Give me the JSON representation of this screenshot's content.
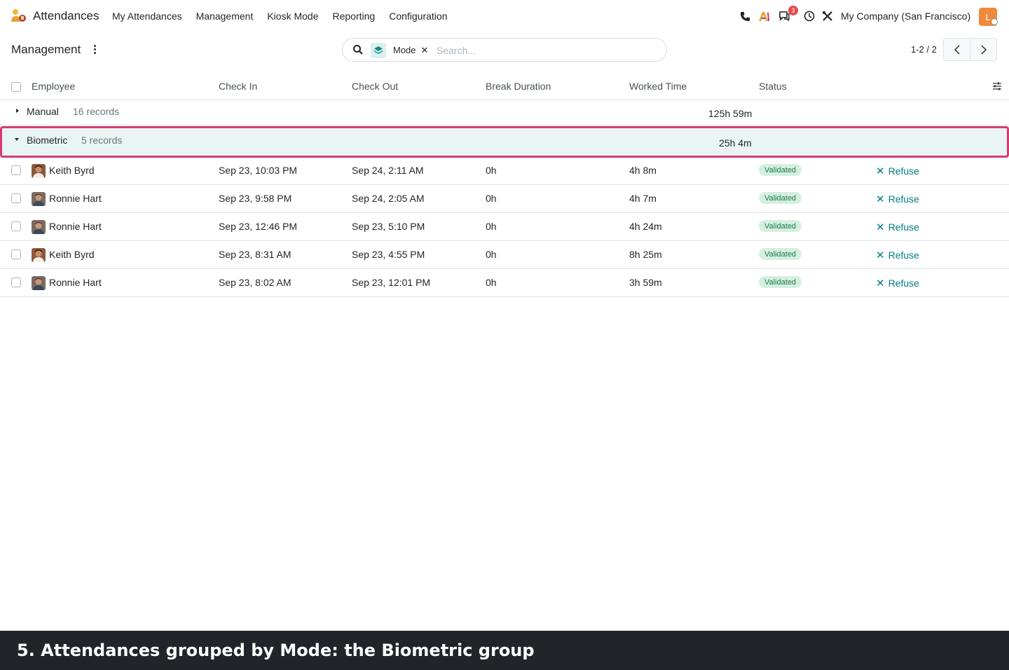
{
  "navbar": {
    "app_name": "Attendances",
    "menu": [
      "My Attendances",
      "Management",
      "Kiosk Mode",
      "Reporting",
      "Configuration"
    ],
    "message_count": "3",
    "company": "My Company (San Francisco)",
    "user_initial": "L",
    "accent_color": "#f08a3a"
  },
  "control_panel": {
    "title": "Management",
    "search": {
      "facet_label": "Mode",
      "placeholder": "Search..."
    },
    "pager": "1-2 / 2"
  },
  "table": {
    "headers": [
      "Employee",
      "Check In",
      "Check Out",
      "Break Duration",
      "Worked Time",
      "Status"
    ],
    "groups": [
      {
        "name": "Manual",
        "count": "16 records",
        "total": "125h 59m",
        "expanded": false
      },
      {
        "name": "Biometric",
        "count": "5 records",
        "total": "25h 4m",
        "expanded": true
      }
    ],
    "rows": [
      {
        "employee": "Keith Byrd",
        "check_in": "Sep 23, 10:03 PM",
        "check_out": "Sep 24, 2:11 AM",
        "break": "0h",
        "worked": "4h 8m",
        "status": "Validated",
        "action": "Refuse"
      },
      {
        "employee": "Ronnie Hart",
        "check_in": "Sep 23, 9:58 PM",
        "check_out": "Sep 24, 2:05 AM",
        "break": "0h",
        "worked": "4h 7m",
        "status": "Validated",
        "action": "Refuse"
      },
      {
        "employee": "Ronnie Hart",
        "check_in": "Sep 23, 12:46 PM",
        "check_out": "Sep 23, 5:10 PM",
        "break": "0h",
        "worked": "4h 24m",
        "status": "Validated",
        "action": "Refuse"
      },
      {
        "employee": "Keith Byrd",
        "check_in": "Sep 23, 8:31 AM",
        "check_out": "Sep 23, 4:55 PM",
        "break": "0h",
        "worked": "8h 25m",
        "status": "Validated",
        "action": "Refuse"
      },
      {
        "employee": "Ronnie Hart",
        "check_in": "Sep 23, 8:02 AM",
        "check_out": "Sep 23, 12:01 PM",
        "break": "0h",
        "worked": "3h 59m",
        "status": "Validated",
        "action": "Refuse"
      }
    ]
  },
  "caption": "5. Attendances grouped by Mode: the Biometric group",
  "colors": {
    "highlight_border": "#d63a71",
    "group_highlight_bg": "#e9f5f3",
    "link": "#017e84",
    "badge_bg": "#d4efe0",
    "badge_text": "#1c7a45"
  }
}
